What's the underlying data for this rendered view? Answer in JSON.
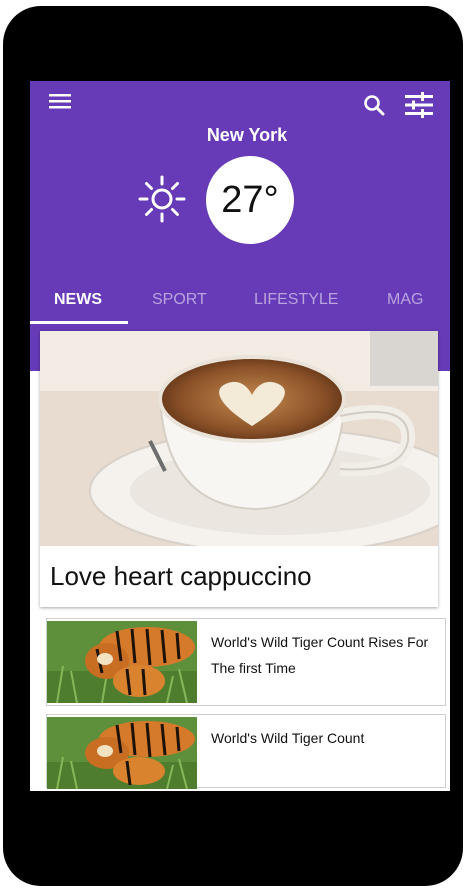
{
  "header": {
    "city": "New York",
    "temperature": "27°",
    "accent_color": "#673ab7",
    "icons": [
      "menu-icon",
      "search-icon",
      "tune-icon",
      "sun-icon"
    ]
  },
  "tabs": [
    {
      "label": "NEWS",
      "active": true
    },
    {
      "label": "SPORT",
      "active": false
    },
    {
      "label": "LIFESTYLE",
      "active": false
    },
    {
      "label": "MAG",
      "active": false
    }
  ],
  "hero": {
    "title": "Love heart cappuccino"
  },
  "articles": [
    {
      "title": "World's Wild Tiger Count Rises For The first Time"
    },
    {
      "title": "World's Wild Tiger Count"
    }
  ]
}
